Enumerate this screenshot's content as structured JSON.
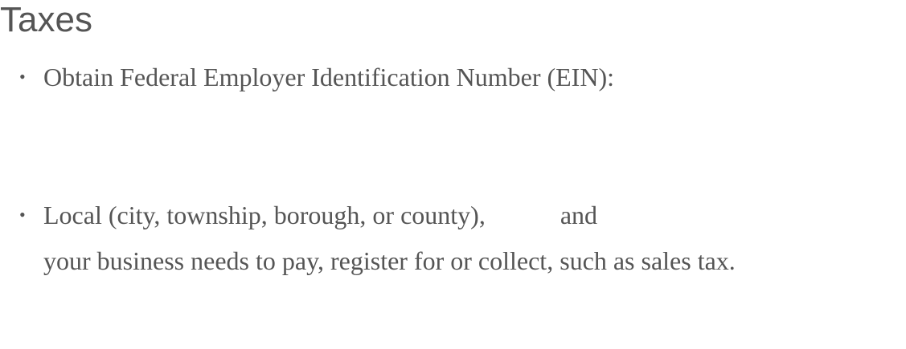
{
  "heading": "Taxes",
  "bullet": "•",
  "items": [
    {
      "text": "Obtain Federal Employer Identification Number (EIN):"
    },
    {
      "line1_part1": "Local (city, township, borough, or county),",
      "line1_part2": "and",
      "line2": "your business needs to pay, register for or collect, such as sales tax."
    }
  ]
}
